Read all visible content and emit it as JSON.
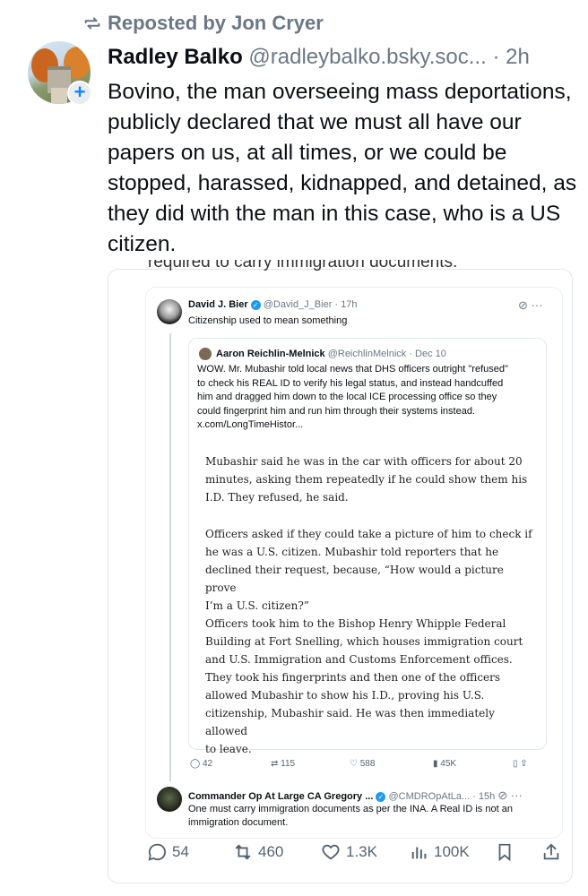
{
  "repost": {
    "label": "Reposted by Jon Cryer"
  },
  "post": {
    "author_name": "Radley Balko",
    "author_handle": "@radleybalko.bsky.soc...",
    "time": "· 2h",
    "text": "Bovino, the man overseeing mass deportations, publicly declared that we must all have our papers on us, at all times, or we could be stopped, harassed, kidnapped, and detained, as they did with the man in this case, who is a US citizen.",
    "cut_text": "required to carry immigration documents."
  },
  "embed": {
    "tweet1": {
      "name": "David J. Bier",
      "handle": "@David_J_Bier · 17h",
      "text": "Citizenship used to mean something"
    },
    "quote": {
      "name": "Aaron Reichlin-Melnick",
      "handle": "@ReichlinMelnick · Dec 10",
      "lines": [
        "WOW. Mr. Mubashir told local news that DHS officers outright \"refused\"",
        "to check his REAL ID to verify his legal status, and instead handcuffed",
        "him and dragged him down to the local ICE processing office so they",
        "could fingerprint him and run him through their systems instead.",
        "x.com/LongTimeHistor..."
      ],
      "para1": [
        "Mubashir said he was in the car with officers for about 20",
        "minutes, asking them repeatedly if he could show them his",
        "I.D. They refused, he said."
      ],
      "para2": [
        "Officers asked if they could take a picture of him to check if",
        "he was a U.S. citizen. Mubashir told reporters that he",
        "declined their request, because, “How would a picture prove",
        "I’m a U.S. citizen?”"
      ],
      "para3": [
        "Officers took him to the Bishop Henry Whipple Federal",
        "Building at Fort Snelling, which houses immigration court",
        "and U.S. Immigration and Customs Enforcement offices.",
        "They took his fingerprints and then one of the officers",
        "allowed Mubashir to show his I.D., proving his U.S.",
        "citizenship, Mubashir said. He was then immediately allowed",
        "to leave."
      ]
    },
    "tweet1_actions": {
      "replies": "42",
      "reposts": "115",
      "likes": "588",
      "views": "45K"
    },
    "tweet2": {
      "name": "Commander Op At Large CA Gregory ...",
      "handle": "@CMDROpAtLa... · 15h",
      "line1": "One must carry immigration documents as per the INA.  A Real ID is not an",
      "line2": "immigration document."
    }
  },
  "actions": {
    "replies": "54",
    "reposts": "460",
    "likes": "1.3K",
    "views": "100K"
  }
}
